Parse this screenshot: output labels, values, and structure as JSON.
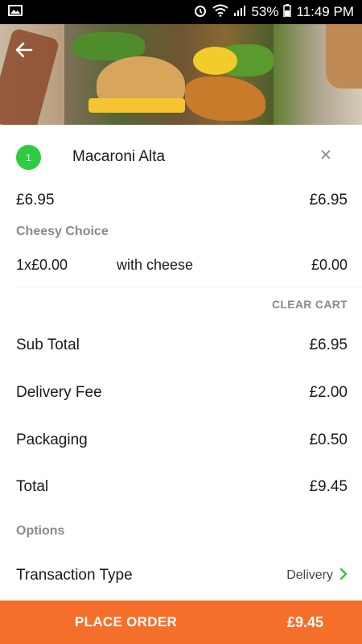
{
  "status_bar": {
    "battery_percent": "53%",
    "time": "11:49 PM",
    "icons": [
      "image-icon",
      "alarm-icon",
      "wifi-icon",
      "signal-icon",
      "battery-icon"
    ]
  },
  "header": {
    "back_icon": "back-arrow-icon"
  },
  "cart_item": {
    "quantity": "1",
    "name": "Macaroni Alta",
    "unit_price": "£6.95",
    "line_total": "£6.95",
    "option_group": "Cheesy Choice",
    "option": {
      "qty_price": "1x£0.00",
      "description": "with cheese",
      "price": "£0.00"
    }
  },
  "clear_cart_label": "CLEAR CART",
  "summary": {
    "sub_total_label": "Sub Total",
    "sub_total_value": "£6.95",
    "delivery_fee_label": "Delivery Fee",
    "delivery_fee_value": "£2.00",
    "packaging_label": "Packaging",
    "packaging_value": "£0.50",
    "total_label": "Total",
    "total_value": "£9.45"
  },
  "options": {
    "heading": "Options",
    "transaction_type_label": "Transaction Type",
    "transaction_type_value": "Delivery"
  },
  "order_bar": {
    "label": "PLACE ORDER",
    "price": "£9.45"
  },
  "colors": {
    "accent_green": "#2ecc40",
    "order_orange": "#f4702a",
    "muted_text": "#8a8a8a"
  }
}
